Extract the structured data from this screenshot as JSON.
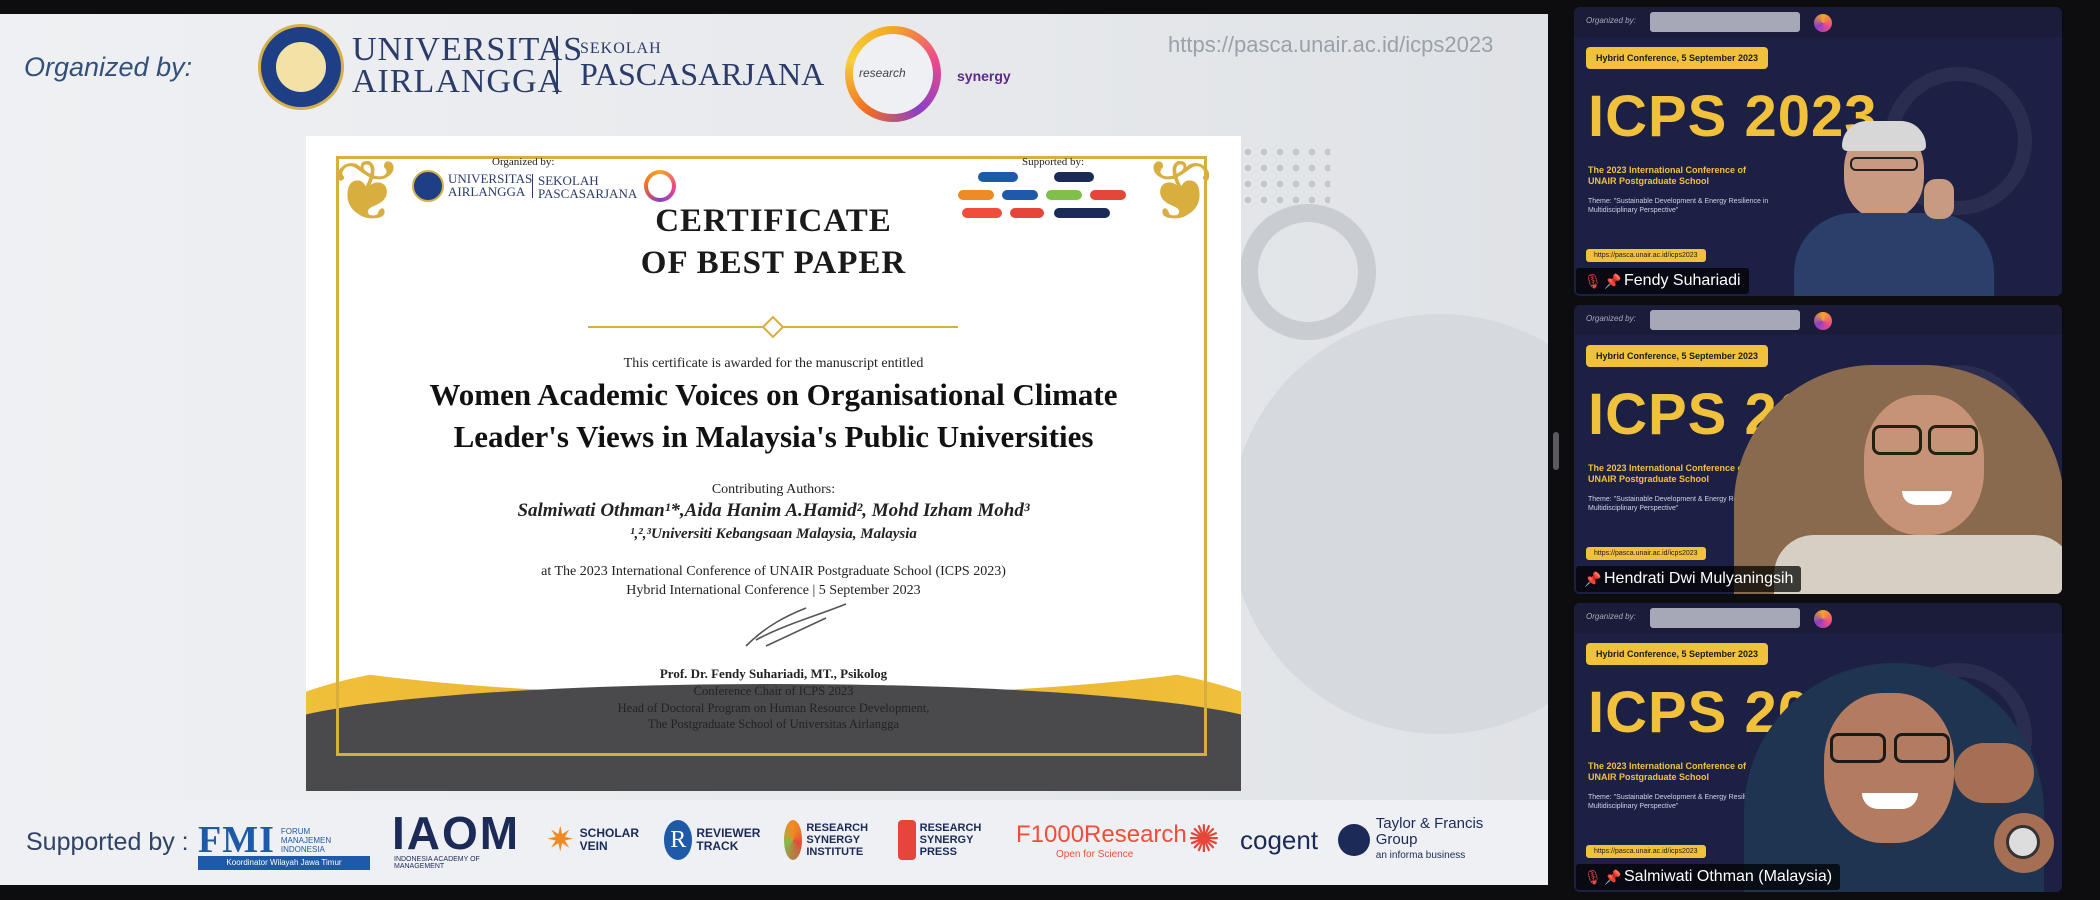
{
  "shared_screen": {
    "header": {
      "organized_by": "Organized by:",
      "university_line1": "UNIVERSITAS",
      "university_line2": "AIRLANGGA",
      "school_line1": "SEKOLAH",
      "school_line2": "PASCASARJANA",
      "research_synergy_left": "research",
      "research_synergy_right": "synergy",
      "url": "https://pasca.unair.ac.id/icps2023"
    },
    "certificate": {
      "organized_by": "Organized by:",
      "mini_ua": "UNIVERSITAS AIRLANGGA",
      "mini_school": "SEKOLAH PASCASARJANA",
      "supported_by": "Supported by:",
      "title_line1": "CERTIFICATE",
      "title_line2": "OF BEST PAPER",
      "awarded_text": "This certificate is awarded for the manuscript entitled",
      "manuscript_line1": "Women Academic Voices on Organisational Climate",
      "manuscript_line2": "Leader's Views in Malaysia's Public Universities",
      "contributing_label": "Contributing Authors:",
      "authors": "Salmiwati Othman¹*,Aida Hanim A.Hamid², Mohd Izham Mohd³",
      "affiliation": "¹,²,³Universiti Kebangsaan Malaysia, Malaysia",
      "event_line1": "at The 2023 International Conference of UNAIR Postgraduate School (ICPS 2023)",
      "event_line2": "Hybrid International Conference | 5 September 2023",
      "signer_name": "Prof. Dr. Fendy Suhariadi, MT., Psikolog",
      "signer_role1": "Conference Chair of ICPS 2023",
      "signer_role2": "Head of Doctoral Program on Human Resource Development,",
      "signer_role3": "The Postgraduate School of Universitas Airlangga"
    },
    "supporters": {
      "label": "Supported by :",
      "fmi_big": "FMI",
      "fmi_small": "FORUM MANAJEMEN INDONESIA",
      "fmi_strip": "Koordinator Wilayah Jawa Timur",
      "iaom_big": "IAOM",
      "iaom_small": "INDONESIA ACADEMY OF MANAGEMENT",
      "scholar_vein": "SCHOLAR VEIN",
      "reviewer_track": "REVIEWER TRACK",
      "research_synergy_institute": "RESEARCH SYNERGY INSTITUTE",
      "research_synergy_press": "RESEARCH SYNERGY PRESS",
      "f1000_big": "F1000Research",
      "f1000_small": "Open for Science",
      "cogent": "cogent",
      "tf_main": "Taylor & Francis Group",
      "tf_sub": "an informa business"
    }
  },
  "participants": [
    {
      "name": "Fendy Suhariadi",
      "muted": true,
      "slide_org": "Organized by:",
      "slide_badge": "Hybrid Conference, 5 September 2023",
      "slide_title": "ICPS 2023",
      "slide_subtitle": "The 2023 International Conference of UNAIR Postgraduate School",
      "slide_theme": "Theme: \"Sustainable Development & Energy Resilience in Multidisciplinary Perspective\"",
      "slide_url": "https://pasca.unair.ac.id/icps2023"
    },
    {
      "name": "Hendrati Dwi Mulyaningsih",
      "muted": false,
      "slide_org": "Organized by:",
      "slide_badge": "Hybrid Conference, 5 September 2023",
      "slide_title": "ICPS 2023",
      "slide_subtitle": "The 2023 International Conference of UNAIR Postgraduate School",
      "slide_theme": "Theme: \"Sustainable Development & Energy Resilience in Multidisciplinary Perspective\"",
      "slide_url": "https://pasca.unair.ac.id/icps2023"
    },
    {
      "name": "Salmiwati Othman (Malaysia)",
      "muted": true,
      "slide_org": "Organized by:",
      "slide_badge": "Hybrid Conference, 5 September 2023",
      "slide_title": "ICPS 2023",
      "slide_subtitle": "The 2023 International Conference of UNAIR Postgraduate School",
      "slide_theme": "Theme: \"Sustainable Development & Energy Resilience in Multidisciplinary Perspective\"",
      "slide_url": "https://pasca.unair.ac.id/icps2023"
    }
  ],
  "icons": {
    "mic_muted": "mic-muted-icon",
    "pin": "pin-icon"
  },
  "colors": {
    "gold": "#f1c13b",
    "navy": "#1b2a57",
    "tile_bg": "#1d2045"
  }
}
